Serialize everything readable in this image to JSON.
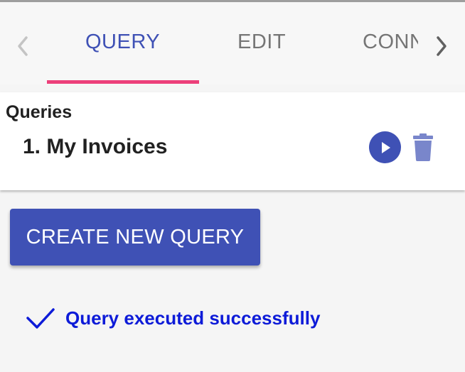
{
  "tabs": {
    "prev_icon": "chevron-left-icon",
    "next_icon": "chevron-right-icon",
    "items": [
      {
        "label": "QUERY",
        "active": true
      },
      {
        "label": "EDIT",
        "active": false
      },
      {
        "label": "CONN",
        "active": false
      }
    ],
    "indicator_color": "#ec407a",
    "active_color": "#3f51b5"
  },
  "queries": {
    "title": "Queries",
    "items": [
      {
        "label": "1. My Invoices",
        "run_icon": "play-icon",
        "delete_icon": "trash-icon"
      }
    ]
  },
  "actions": {
    "create_label": "CREATE NEW QUERY",
    "button_color": "#3f51b5"
  },
  "status": {
    "icon": "checkmark-icon",
    "message": "Query executed successfully",
    "color": "#0d1bd8"
  }
}
